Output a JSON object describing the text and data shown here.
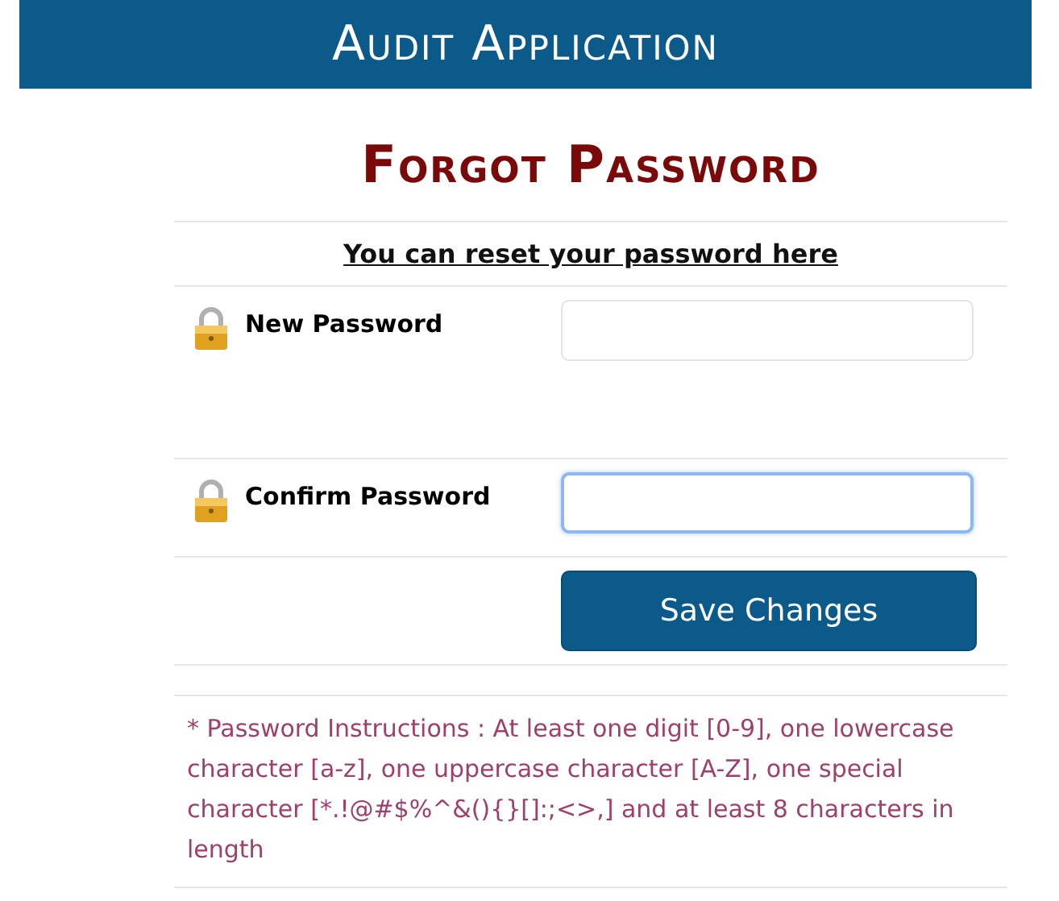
{
  "header": {
    "title": "Audit Application"
  },
  "form": {
    "title": "Forgot Password",
    "subtitle": "You can reset your password here",
    "fields": [
      {
        "label": "New Password",
        "focused": false
      },
      {
        "label": "Confirm Password",
        "focused": true
      }
    ],
    "button": "Save Changes",
    "instructions": "* Password Instructions : At least one digit [0-9], one lowercase character [a-z], one uppercase character [A-Z], one special character [*.!@#$%^&(){}[]:;<>,] and at least 8 characters in length"
  }
}
